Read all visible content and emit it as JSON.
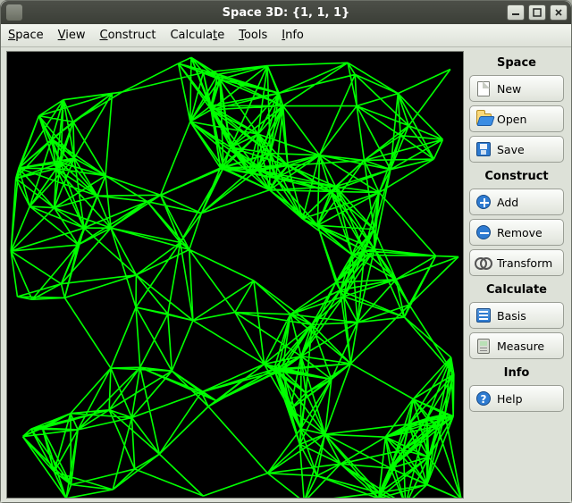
{
  "window": {
    "title": "Space 3D: {1, 1, 1}"
  },
  "menubar": {
    "items": [
      {
        "label": "Space",
        "mnemonic_index": 0
      },
      {
        "label": "View",
        "mnemonic_index": 0
      },
      {
        "label": "Construct",
        "mnemonic_index": 0
      },
      {
        "label": "Calculate",
        "mnemonic_index": 7
      },
      {
        "label": "Tools",
        "mnemonic_index": 0
      },
      {
        "label": "Info",
        "mnemonic_index": 0
      }
    ]
  },
  "sidebar": {
    "sections": [
      {
        "header": "Space",
        "buttons": [
          {
            "id": "new",
            "label": "New",
            "icon": "file-icon"
          },
          {
            "id": "open",
            "label": "Open",
            "icon": "folder-open-icon"
          },
          {
            "id": "save",
            "label": "Save",
            "icon": "floppy-disk-icon"
          }
        ]
      },
      {
        "header": "Construct",
        "buttons": [
          {
            "id": "add",
            "label": "Add",
            "icon": "plus-circle-icon"
          },
          {
            "id": "remove",
            "label": "Remove",
            "icon": "minus-circle-icon"
          },
          {
            "id": "transform",
            "label": "Transform",
            "icon": "scissors-icon"
          }
        ]
      },
      {
        "header": "Calculate",
        "buttons": [
          {
            "id": "basis",
            "label": "Basis",
            "icon": "grid-icon"
          },
          {
            "id": "measure",
            "label": "Measure",
            "icon": "calculator-icon"
          }
        ]
      },
      {
        "header": "Info",
        "buttons": [
          {
            "id": "help",
            "label": "Help",
            "icon": "help-circle-icon"
          }
        ]
      }
    ]
  },
  "canvas": {
    "line_color": "#00ff00",
    "background": "#000000"
  }
}
